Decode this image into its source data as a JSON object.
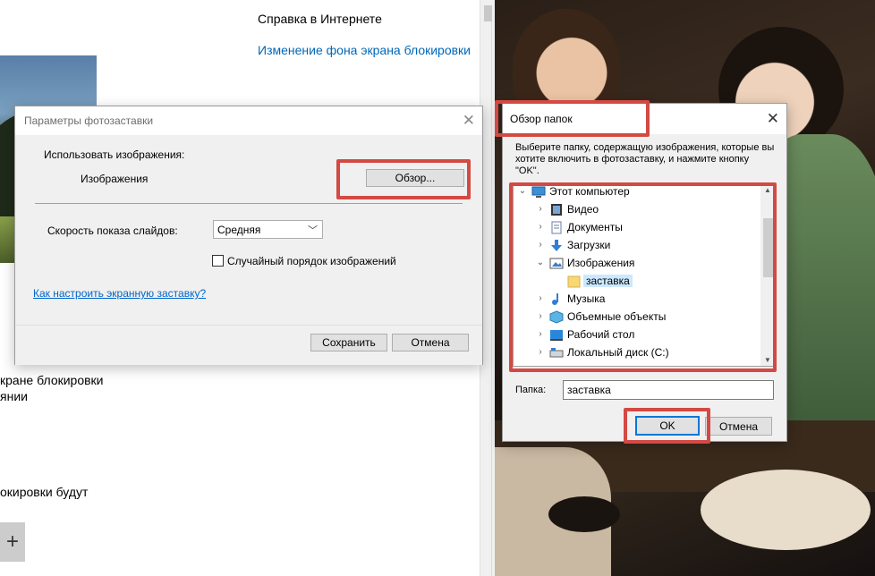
{
  "settings": {
    "help_title": "Справка в Интернете",
    "help_link": "Изменение фона экрана блокировки",
    "text1": "крaне блокировки",
    "text2": "янии",
    "text3": "окировки будут",
    "plus": "+"
  },
  "screensaver_dialog": {
    "title": "Параметры фотозаставки",
    "use_images_label": "Использовать изображения:",
    "folder_value": "Изображения",
    "browse_button": "Обзор...",
    "speed_label": "Скорость показа слайдов:",
    "speed_value": "Средняя",
    "shuffle_label": "Случайный порядок изображений",
    "shuffle_checked": false,
    "help_link": "Как настроить экранную заставку?",
    "save_button": "Сохранить",
    "cancel_button": "Отмена"
  },
  "browse_dialog": {
    "title": "Обзор папок",
    "instructions": "Выберите папку, содержащую изображения, которые вы хотите включить в фотозаставку, и нажмите кнопку \"OK\".",
    "tree": [
      {
        "label": "Этот компьютер",
        "icon": "computer-icon",
        "expander": "collapse"
      },
      {
        "label": "Видео",
        "icon": "video-folder-icon",
        "expander": "expand"
      },
      {
        "label": "Документы",
        "icon": "documents-folder-icon",
        "expander": "expand"
      },
      {
        "label": "Загрузки",
        "icon": "downloads-folder-icon",
        "expander": "expand"
      },
      {
        "label": "Изображения",
        "icon": "pictures-folder-icon",
        "expander": "collapse"
      },
      {
        "label": "заставка",
        "icon": "folder-icon",
        "selected": true
      },
      {
        "label": "Музыка",
        "icon": "music-folder-icon",
        "expander": "expand"
      },
      {
        "label": "Объемные объекты",
        "icon": "3d-objects-folder-icon",
        "expander": "expand"
      },
      {
        "label": "Рабочий стол",
        "icon": "desktop-folder-icon",
        "expander": "expand"
      },
      {
        "label": "Локальный диск (C:)",
        "icon": "drive-icon",
        "expander": "expand"
      }
    ],
    "folder_label": "Папка:",
    "folder_value": "заставка",
    "ok_button": "OK",
    "cancel_button": "Отмена"
  },
  "colors": {
    "highlight": "#d24a43",
    "link": "#0067b8",
    "selection": "#cce8ff"
  }
}
